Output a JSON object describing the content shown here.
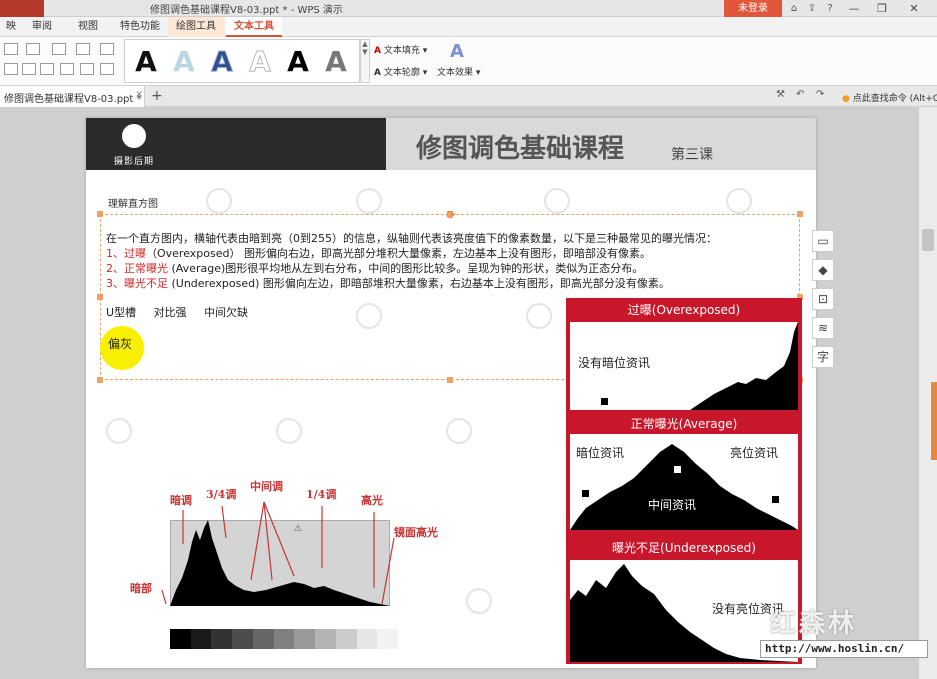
{
  "window": {
    "title": "修图调色基础课程V8-03.ppt * - WPS 演示",
    "login": "未登录",
    "minimize": "—",
    "restore": "❐",
    "close": "✕"
  },
  "ribbon_tabs": [
    "映",
    "审阅",
    "视图",
    "特色功能",
    "绘图工具",
    "文本工具"
  ],
  "ribbon": {
    "style_letter": "A",
    "text_fill": "文本填充",
    "text_outline": "文本轮廓",
    "text_effect": "文本效果"
  },
  "doc_tab": {
    "name": "修图调色基础课程V8-03.ppt *",
    "close": "×",
    "new": "+",
    "search_tip": "点此查找命令 (Alt+Q)"
  },
  "slide": {
    "logo_text": "摄影后期",
    "title": "修图调色基础课程",
    "lesson": "第三课",
    "subtitle": "理解直方图",
    "para0": "在一个直方图内，横轴代表由暗到亮（0到255）的信息，纵轴则代表该亮度值下的像素数量，以下是三种最常见的曝光情况：",
    "para1_red": "1、过曝",
    "para1_rest": "（Overexposed） 图形偏向右边，即高光部分堆积大量像素，左边基本上没有图形，即暗部没有像素。",
    "para2_red": "2、正常曝光",
    "para2_rest": " (Average)图形很平均地从左到右分布，中间的图形比较多。呈现为钟的形状，类似为正态分布。",
    "para3_red": "3、曝光不足",
    "para3_rest": " (Underexposed) 图形偏向左边，即暗部堆积大量像素，右边基本上没有图形，即高光部分没有像素。",
    "label_u": "U型槽",
    "label_contrast": "对比强",
    "label_mid": "中间欠缺",
    "label_gray": "偏灰",
    "ann_dark_tone": "暗调",
    "ann_34": "3/4调",
    "ann_mid": "中间调",
    "ann_14": "1/4调",
    "ann_high": "高光",
    "ann_specular": "镜面高光",
    "ann_dark": "暗部"
  },
  "right_panel": {
    "over_title": "过曝(Overexposed)",
    "over_label": "没有暗位资讯",
    "avg_title": "正常曝光(Average)",
    "avg_dark": "暗位资讯",
    "avg_mid": "中间资讯",
    "avg_bright": "亮位资讯",
    "under_title": "曝光不足(Underexposed)",
    "under_label": "没有亮位资讯"
  },
  "side_tools": [
    "▭",
    "◆",
    "⊡",
    "≋",
    "字"
  ],
  "watermark": {
    "name": "红森林",
    "url": "http://www.hoslin.cn/"
  },
  "colors": {
    "accent": "#d2553a",
    "red_text": "#d02a2a",
    "panel_red": "#c8172b",
    "highlight": "#f8f000"
  }
}
